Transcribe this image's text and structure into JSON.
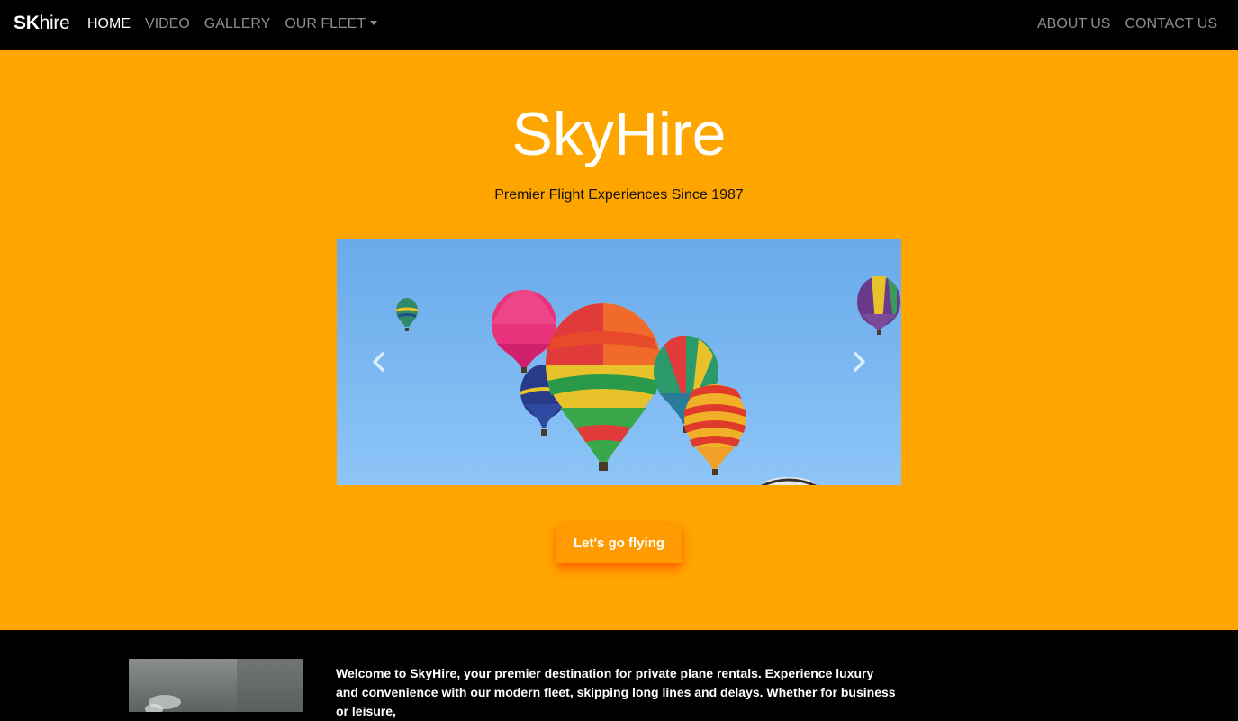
{
  "navbar": {
    "brand_bold": "SK",
    "brand_light": "hire",
    "left_links": [
      {
        "label": "HOME",
        "active": true
      },
      {
        "label": "VIDEO",
        "active": false
      },
      {
        "label": "GALLERY",
        "active": false
      },
      {
        "label": "OUR FLEET",
        "active": false,
        "dropdown": true
      }
    ],
    "right_links": [
      {
        "label": "ABOUT US"
      },
      {
        "label": "CONTACT US"
      }
    ]
  },
  "hero": {
    "title": "SkyHire",
    "subtitle": "Premier Flight Experiences Since 1987",
    "background_color": "#ffa500",
    "carousel": {
      "prev_icon": "chevron-left-icon",
      "next_icon": "chevron-right-icon"
    },
    "cta_label": "Let's go flying"
  },
  "intro": {
    "text": "Welcome to SkyHire, your premier destination for private plane rentals. Experience luxury and convenience with our modern fleet, skipping long lines and delays. Whether for business or leisure,"
  }
}
